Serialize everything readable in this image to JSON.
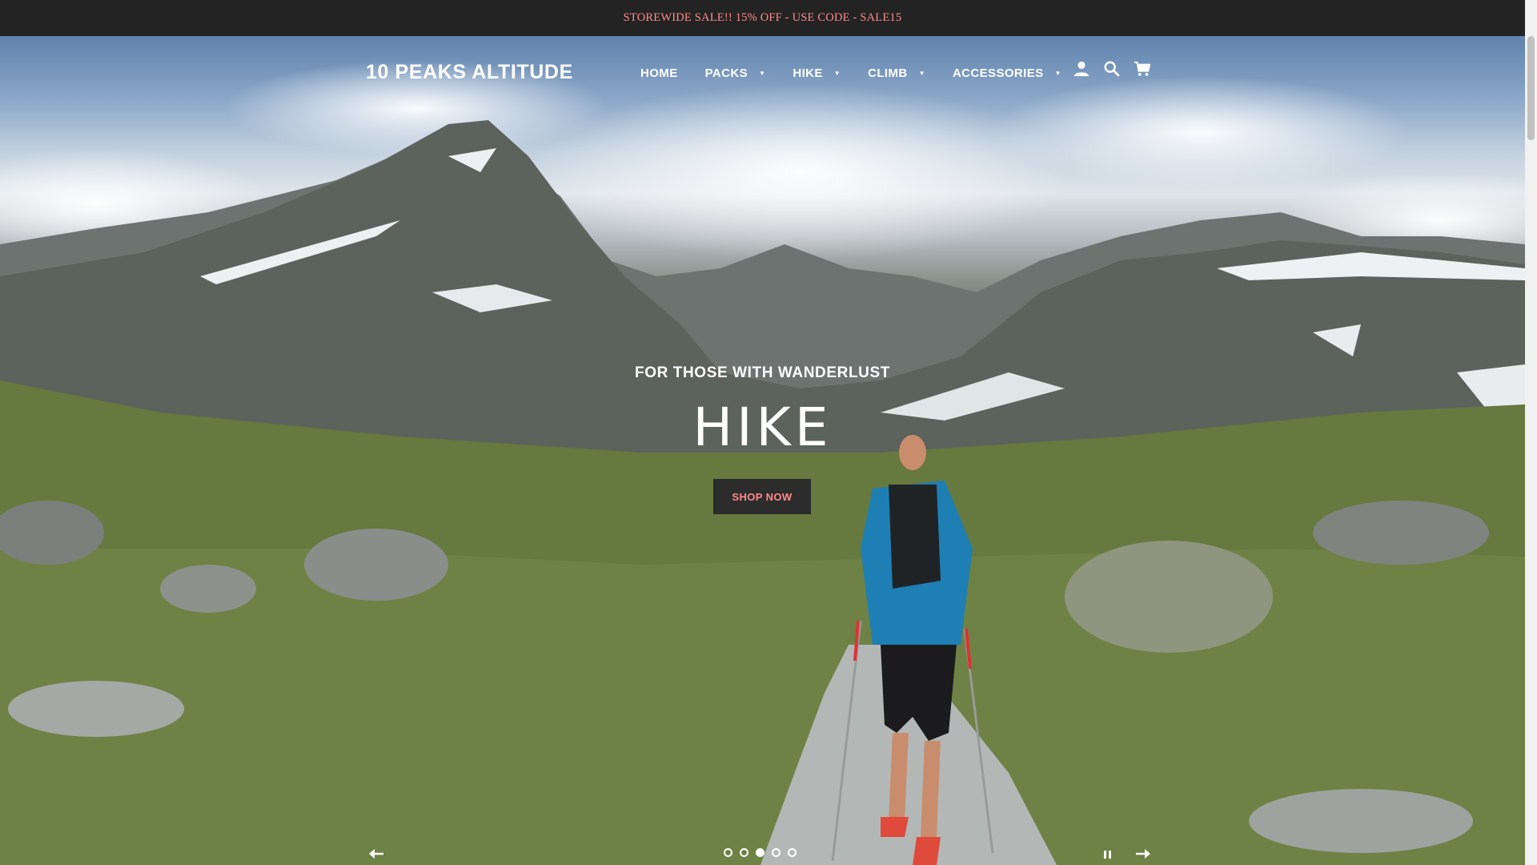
{
  "announcement": {
    "text": "STOREWIDE SALE!! 15% OFF - USE CODE - SALE15"
  },
  "header": {
    "site_name": "10 PEAKS ALTITUDE",
    "nav": [
      {
        "label": "HOME",
        "dropdown": false
      },
      {
        "label": "PACKS",
        "dropdown": true
      },
      {
        "label": "HIKE",
        "dropdown": true
      },
      {
        "label": "CLIMB",
        "dropdown": true
      },
      {
        "label": "ACCESSORIES",
        "dropdown": true
      }
    ],
    "icons": [
      "account-icon",
      "search-icon",
      "cart-icon"
    ],
    "caret_glyph": "▼"
  },
  "hero": {
    "eyebrow": "FOR THOSE WITH WANDERLUST",
    "headline": "HIKE",
    "cta_label": "SHOP NOW"
  },
  "slideshow": {
    "slide_count": 5,
    "active_slide": 3,
    "controls": [
      "prev-arrow-icon",
      "pause-icon",
      "next-arrow-icon"
    ]
  },
  "colors": {
    "announcement_bg": "#232323",
    "announcement_text": "#ff8a8a",
    "cta_bg": "#2c2c2c",
    "cta_text": "#ff8a8a"
  }
}
